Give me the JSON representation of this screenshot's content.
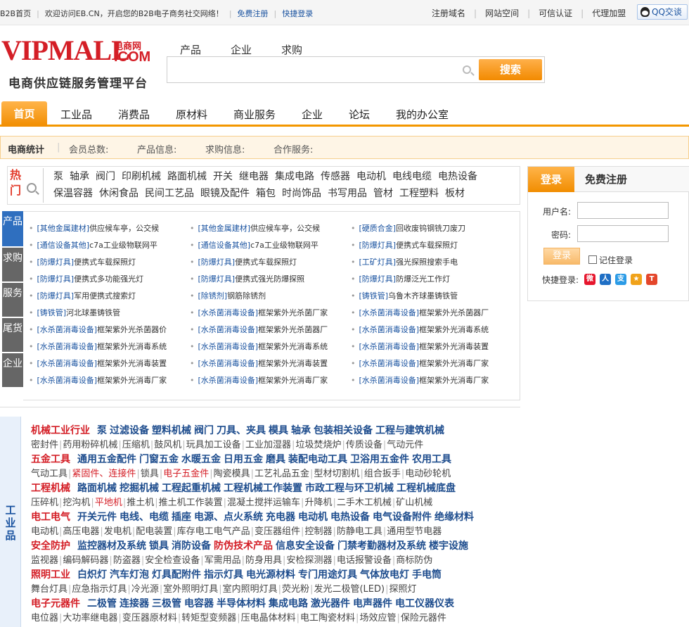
{
  "topbar": {
    "left": [
      "B2B首页",
      "欢迎访问EB.CN，开启您的B2B电子商务社交网络！",
      "免费注册",
      "快捷登录"
    ],
    "right": [
      "注册域名",
      "网站空间",
      "可信认证",
      "代理加盟"
    ],
    "qq_label": "QQ交谈"
  },
  "logo": {
    "main": "VIPMALL",
    "cn": "电商网",
    "com": ".COM",
    "slogan": "电商供应链服务管理平台"
  },
  "search": {
    "tabs": [
      "产品",
      "企业",
      "求购"
    ],
    "placeholder": "",
    "button": "搜索"
  },
  "nav": [
    "首页",
    "工业品",
    "消费品",
    "原材料",
    "商业服务",
    "企业",
    "论坛",
    "我的办公室"
  ],
  "stats": {
    "title": "电商统计",
    "items": [
      "会员总数:",
      "产品信息:",
      "求购信息:",
      "合作服务:"
    ]
  },
  "hot": {
    "label1": "热",
    "label2": "门",
    "words": [
      "泵",
      "轴承",
      "阀门",
      "印刷机械",
      "路面机械",
      "开关",
      "继电器",
      "集成电路",
      "传感器",
      "电动机",
      "电线电缆",
      "电热设备",
      "保温容器",
      "休闲食品",
      "民间工艺品",
      "眼镜及配件",
      "箱包",
      "时尚饰品",
      "书写用品",
      "管材",
      "工程塑料",
      "板材"
    ]
  },
  "login": {
    "tab_login": "登录",
    "tab_register": "免费注册",
    "username_label": "用户名:",
    "password_label": "密码:",
    "button": "登录",
    "remember": "记住登录",
    "quick": "快捷登录:",
    "icons": [
      "weibo-icon",
      "renren-icon",
      "alipay-icon",
      "qzone-icon",
      "taobao-icon"
    ]
  },
  "side_tabs": [
    "产品",
    "求购",
    "服务",
    "尾货",
    "企业"
  ],
  "products": [
    [
      {
        "cat": "[其他金属建材]",
        "name": "供应候车亭，公交候"
      },
      {
        "cat": "[通信设备其他]",
        "name": "c7a工业级物联网平"
      },
      {
        "cat": "[防爆灯具]",
        "name": "便携式车载探照灯"
      },
      {
        "cat": "[防爆灯具]",
        "name": "便携式多功能强光灯"
      },
      {
        "cat": "[防爆灯具]",
        "name": "军用便携式搜索灯"
      },
      {
        "cat": "[铸铁管]",
        "name": "河北球墨铸铁管"
      },
      {
        "cat": "[水杀菌消毒设备]",
        "name": "框架紫外光杀菌器价"
      },
      {
        "cat": "[水杀菌消毒设备]",
        "name": "框架紫外光消毒系统"
      },
      {
        "cat": "[水杀菌消毒设备]",
        "name": "框架紫外光消毒装置"
      },
      {
        "cat": "[水杀菌消毒设备]",
        "name": "框架紫外光消毒厂家"
      }
    ],
    [
      {
        "cat": "[其他金属建材]",
        "name": "供应候车亭，公交候"
      },
      {
        "cat": "[通信设备其他]",
        "name": "c7a工业级物联网平"
      },
      {
        "cat": "[防爆灯具]",
        "name": "便携式车载探照灯"
      },
      {
        "cat": "[防爆灯具]",
        "name": "便携式强光防爆探照"
      },
      {
        "cat": "[除锈剂]",
        "name": "钢筋除锈剂"
      },
      {
        "cat": "[水杀菌消毒设备]",
        "name": "框架紫外光杀菌厂家"
      },
      {
        "cat": "[水杀菌消毒设备]",
        "name": "框架紫外光杀菌器厂"
      },
      {
        "cat": "[水杀菌消毒设备]",
        "name": "框架紫外光消毒系统"
      },
      {
        "cat": "[水杀菌消毒设备]",
        "name": "框架紫外光消毒装置"
      },
      {
        "cat": "[水杀菌消毒设备]",
        "name": "框架紫外光消毒厂家"
      }
    ],
    [
      {
        "cat": "[硬质合金]",
        "name": "回收废钨钢铣刀废刀"
      },
      {
        "cat": "[防爆灯具]",
        "name": "便携式车载探照灯"
      },
      {
        "cat": "[工矿灯具]",
        "name": "强光探照搜索手电"
      },
      {
        "cat": "[防爆灯具]",
        "name": "防爆泛光工作灯"
      },
      {
        "cat": "[铸铁管]",
        "name": "乌鲁木齐球墨铸铁管"
      },
      {
        "cat": "[水杀菌消毒设备]",
        "name": "框架紫外光杀菌器厂"
      },
      {
        "cat": "[水杀菌消毒设备]",
        "name": "框架紫外光消毒系统"
      },
      {
        "cat": "[水杀菌消毒设备]",
        "name": "框架紫外光消毒装置"
      },
      {
        "cat": "[水杀菌消毒设备]",
        "name": "框架紫外光消毒厂家"
      },
      {
        "cat": "[水杀菌消毒设备]",
        "name": "框架紫外光消毒厂家"
      }
    ]
  ],
  "industry_side": "工业品",
  "industries": [
    {
      "head": "机械工业行业",
      "subs": [
        "泵",
        "过滤设备",
        "塑料机械",
        "阀门",
        "刀具、夹具",
        "模具",
        "轴承",
        "包装相关设备",
        "工程与建筑机械"
      ],
      "items": [
        "密封件",
        "药用粉碎机械",
        "压缩机",
        "鼓风机",
        "玩具加工设备",
        "工业加湿器",
        "垃圾焚烧炉",
        "传质设备",
        "气动元件"
      ],
      "red": []
    },
    {
      "head": "五金工具",
      "subs": [
        "通用五金配件",
        "门窗五金",
        "水暖五金",
        "日用五金",
        "磨具",
        "装配电动工具",
        "卫浴用五金件",
        "农用工具"
      ],
      "items": [
        "气动工具",
        "紧固件、连接件",
        "锁具",
        "电子五金件",
        "陶瓷模具",
        "工艺礼品五金",
        "型材切割机",
        "组合扳手",
        "电动砂轮机"
      ],
      "red": [
        1,
        3
      ]
    },
    {
      "head": "工程机械",
      "subs": [
        "路面机械",
        "挖掘机械",
        "工程起重机械",
        "工程机械工作装置",
        "市政工程与环卫机械",
        "工程机械底盘"
      ],
      "items": [
        "压碎机",
        "挖沟机",
        "平地机",
        "推土机",
        "推土机工作装置",
        "混凝土搅拌运输车",
        "升降机",
        "二手木工机械",
        "矿山机械"
      ],
      "red": [
        2
      ]
    },
    {
      "head": "电工电气",
      "subs": [
        "开关元件",
        "电线、电缆",
        "插座",
        "电源、点火系统",
        "充电器",
        "电动机",
        "电热设备",
        "电气设备附件",
        "绝缘材料"
      ],
      "items": [
        "电动机",
        "高压电器",
        "发电机",
        "配电装置",
        "库存电工电气产品",
        "变压器组件",
        "控制器",
        "防静电工具",
        "通用型节电器"
      ],
      "red": []
    },
    {
      "head": "安全防护",
      "subs": [
        "监控器材及系统",
        "锁具",
        "消防设备",
        "防伪技术产品",
        "信息安全设备",
        "门禁考勤器材及系统",
        "楼宇设施"
      ],
      "items": [
        "监视器",
        "编码解码器",
        "防盗器",
        "安全检查设备",
        "军需用品",
        "防身用具",
        "安检探测器",
        "电话报警设备",
        "商标防伪"
      ],
      "red": [],
      "redsub": [
        3
      ]
    },
    {
      "head": "照明工业",
      "subs": [
        "白炽灯",
        "汽车灯泡",
        "灯具配附件",
        "指示灯具",
        "电光源材料",
        "专门用途灯具",
        "气体放电灯",
        "手电筒"
      ],
      "items": [
        "舞台灯具",
        "应急指示灯具",
        "冷光源",
        "室外照明灯具",
        "室内照明灯具",
        "荧光粉",
        "发光二极管(LED)",
        "探照灯"
      ],
      "red": []
    },
    {
      "head": "电子元器件",
      "subs": [
        "二极管",
        "连接器",
        "三极管",
        "电容器",
        "半导体材料",
        "集成电路",
        "激光器件",
        "电声器件",
        "电工仪器仪表"
      ],
      "items": [
        "电位器",
        "大功率继电器",
        "变压器原材料",
        "转矩型变频器",
        "压电晶体材料",
        "电工陶瓷材料",
        "场效应管",
        "保险元器件"
      ],
      "red": []
    }
  ]
}
